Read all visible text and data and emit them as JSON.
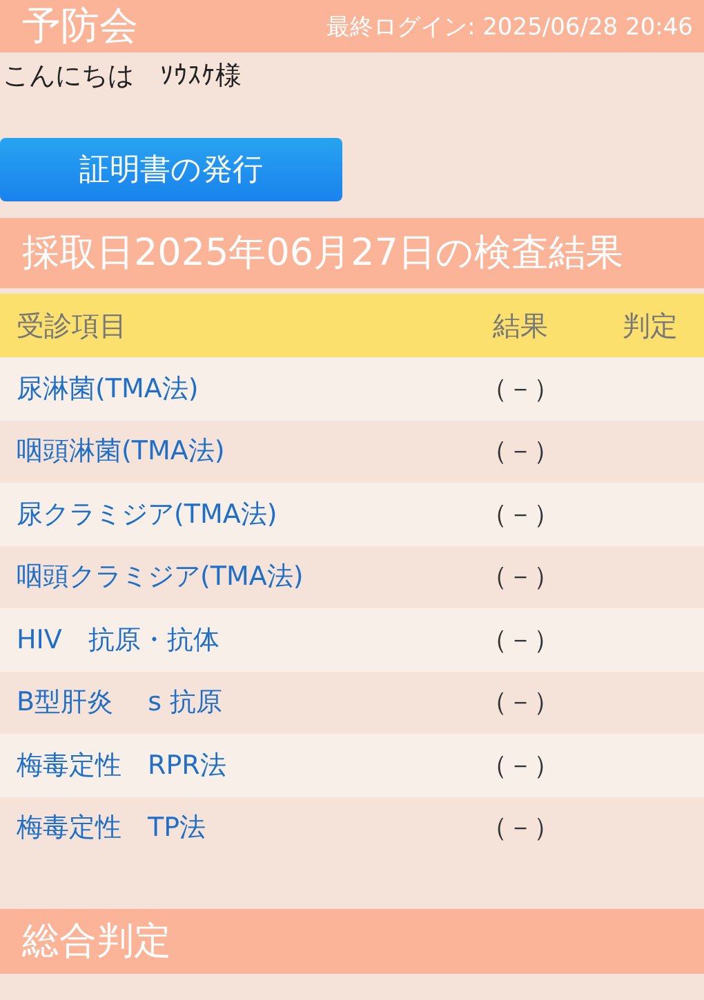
{
  "header": {
    "title": "予防会",
    "last_login": "最終ログイン: 2025/06/28 20:46"
  },
  "greeting": "こんにちは　ｿｳｽｹ様",
  "certificate_button": "証明書の発行",
  "results": {
    "heading": "採取日2025年06月27日の検査結果",
    "columns": [
      "受診項目",
      "結果",
      "判定"
    ],
    "rows": [
      {
        "item": "尿淋菌(TMA法)",
        "result": "（－）"
      },
      {
        "item": "咽頭淋菌(TMA法)",
        "result": "（－）"
      },
      {
        "item": "尿クラミジア(TMA法)",
        "result": "（－）"
      },
      {
        "item": "咽頭クラミジア(TMA法)",
        "result": "（－）"
      },
      {
        "item": "HIV　抗原・抗体",
        "result": "（－）"
      },
      {
        "item": "B型肝炎　 s 抗原",
        "result": "（－）"
      },
      {
        "item": "梅毒定性　RPR法",
        "result": "（－）"
      },
      {
        "item": "梅毒定性　TP法",
        "result": "（－）"
      }
    ]
  },
  "overall": {
    "heading": "総合判定"
  }
}
